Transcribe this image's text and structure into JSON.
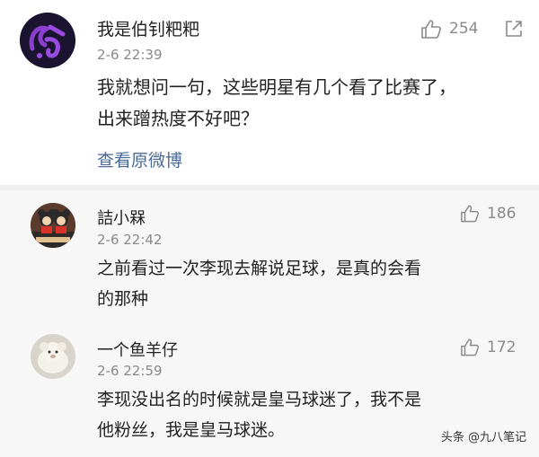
{
  "comments": [
    {
      "username": "我是伯钊粑粑",
      "time": "2-6 22:39",
      "likes": "254",
      "lines": [
        "我就想问一句，这些明星有几个看了比赛了，",
        "出来蹭热度不好吧？"
      ],
      "link": "查看原微博"
    },
    {
      "username": "詰小槑",
      "time": "2-6 22:42",
      "likes": "186",
      "lines": [
        "之前看过一次李现去解说足球，是真的会看",
        "的那种"
      ]
    },
    {
      "username": "一个鱼羊仔",
      "time": "2-6 22:59",
      "likes": "172",
      "lines": [
        "李现没出名的时候就是皇马球迷了，我不是",
        "他粉丝，我是皇马球迷。"
      ]
    }
  ],
  "watermark": "头条 @九八笔记",
  "colors": {
    "link": "#4a6b96",
    "meta": "#8a8a8a",
    "reply_bg": "#f7f7f7"
  }
}
